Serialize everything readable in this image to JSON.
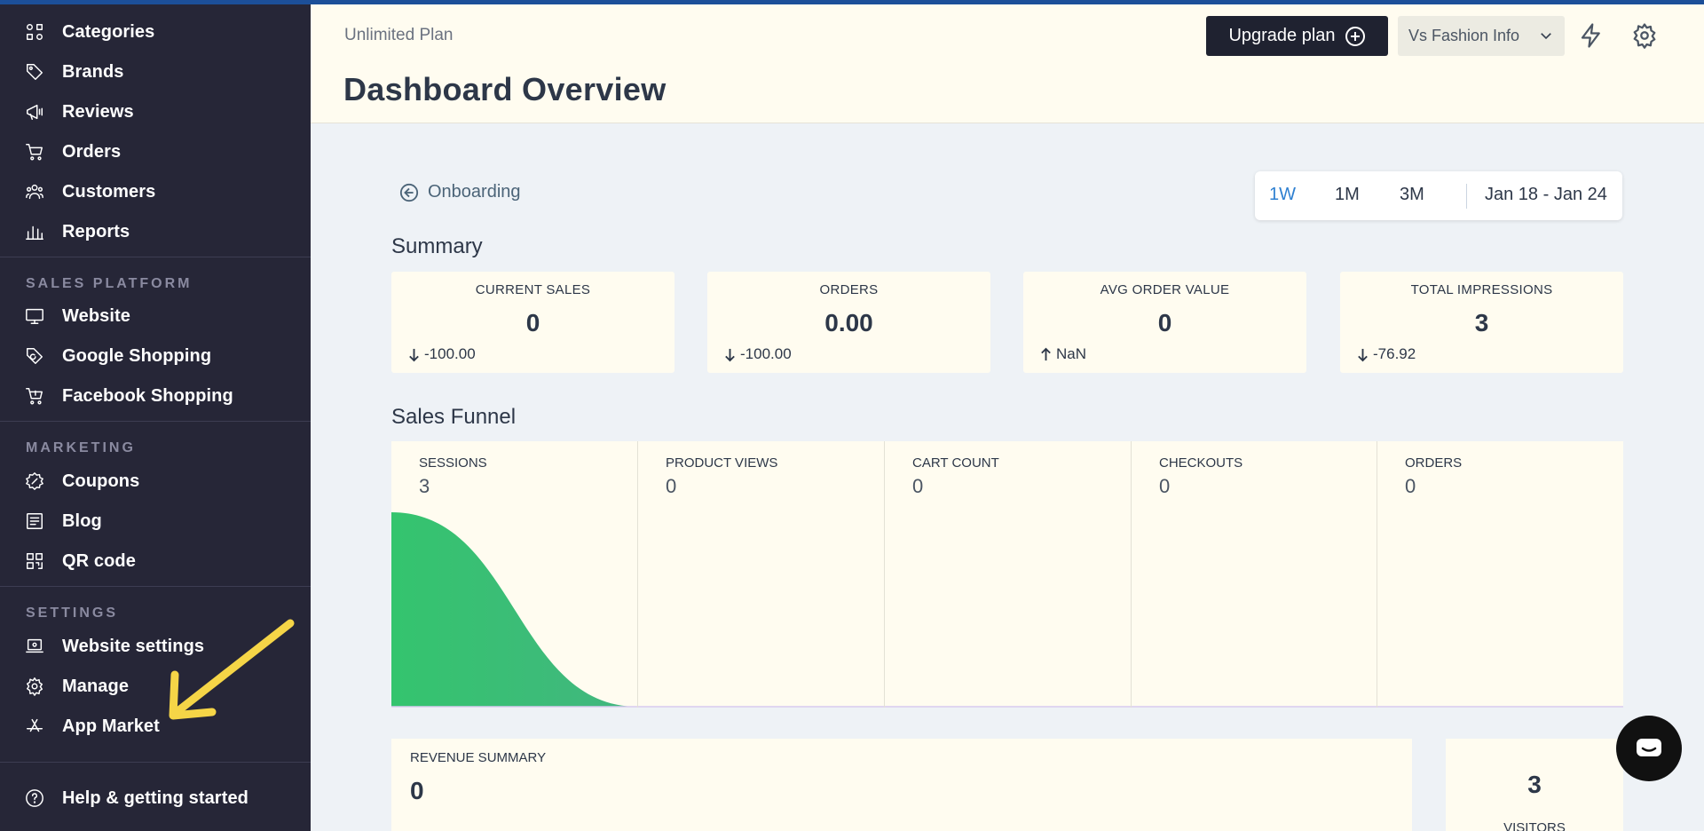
{
  "sidebar": {
    "top_items": [
      {
        "label": "Categories",
        "icon": "categories-icon"
      },
      {
        "label": "Brands",
        "icon": "tag-icon"
      },
      {
        "label": "Reviews",
        "icon": "megaphone-icon"
      },
      {
        "label": "Orders",
        "icon": "cart-icon"
      },
      {
        "label": "Customers",
        "icon": "users-icon"
      },
      {
        "label": "Reports",
        "icon": "bar-chart-icon"
      }
    ],
    "sales_platform": {
      "title": "SALES PLATFORM",
      "items": [
        {
          "label": "Website",
          "icon": "monitor-icon"
        },
        {
          "label": "Google Shopping",
          "icon": "google-tag-icon"
        },
        {
          "label": "Facebook Shopping",
          "icon": "cart-icon"
        }
      ]
    },
    "marketing": {
      "title": "MARKETING",
      "items": [
        {
          "label": "Coupons",
          "icon": "coupon-icon"
        },
        {
          "label": "Blog",
          "icon": "blog-icon"
        },
        {
          "label": "QR code",
          "icon": "qr-code-icon"
        }
      ]
    },
    "settings": {
      "title": "SETTINGS",
      "items": [
        {
          "label": "Website settings",
          "icon": "laptop-settings-icon"
        },
        {
          "label": "Manage",
          "icon": "gear-icon"
        },
        {
          "label": "App Market",
          "icon": "app-store-icon"
        }
      ]
    },
    "help": {
      "label": "Help & getting started",
      "icon": "help-circle-icon"
    }
  },
  "header": {
    "plan": "Unlimited Plan",
    "title": "Dashboard Overview",
    "upgrade_label": "Upgrade plan",
    "store_name": "Vs Fashion Info"
  },
  "dashboard": {
    "onboarding_label": "Onboarding",
    "ranges": [
      "1W",
      "1M",
      "3M"
    ],
    "active_range": "1W",
    "date_range": "Jan 18 - Jan 24",
    "summary_title": "Summary",
    "summary_cards": [
      {
        "title": "CURRENT SALES",
        "value": "0",
        "delta": "-100.00",
        "direction": "down"
      },
      {
        "title": "ORDERS",
        "value": "0.00",
        "delta": "-100.00",
        "direction": "down"
      },
      {
        "title": "AVG ORDER VALUE",
        "value": "0",
        "delta": "NaN",
        "direction": "up"
      },
      {
        "title": "TOTAL IMPRESSIONS",
        "value": "3",
        "delta": "-76.92",
        "direction": "down"
      }
    ],
    "funnel_title": "Sales Funnel",
    "funnel": [
      {
        "label": "SESSIONS",
        "value": 3
      },
      {
        "label": "PRODUCT VIEWS",
        "value": 0
      },
      {
        "label": "CART COUNT",
        "value": 0
      },
      {
        "label": "CHECKOUTS",
        "value": 0
      },
      {
        "label": "ORDERS",
        "value": 0
      }
    ],
    "revenue": {
      "title": "REVENUE SUMMARY",
      "value": "0"
    },
    "visitors": {
      "title": "VISITORS",
      "value": "3"
    }
  },
  "colors": {
    "sidebar_bg": "#262637",
    "header_bg": "#fffcf0",
    "accent_blue": "#2f80d1",
    "funnel_gradient_start": "#34c46e",
    "funnel_gradient_end": "#7a7fc4",
    "annotation_arrow": "#f5d547"
  }
}
